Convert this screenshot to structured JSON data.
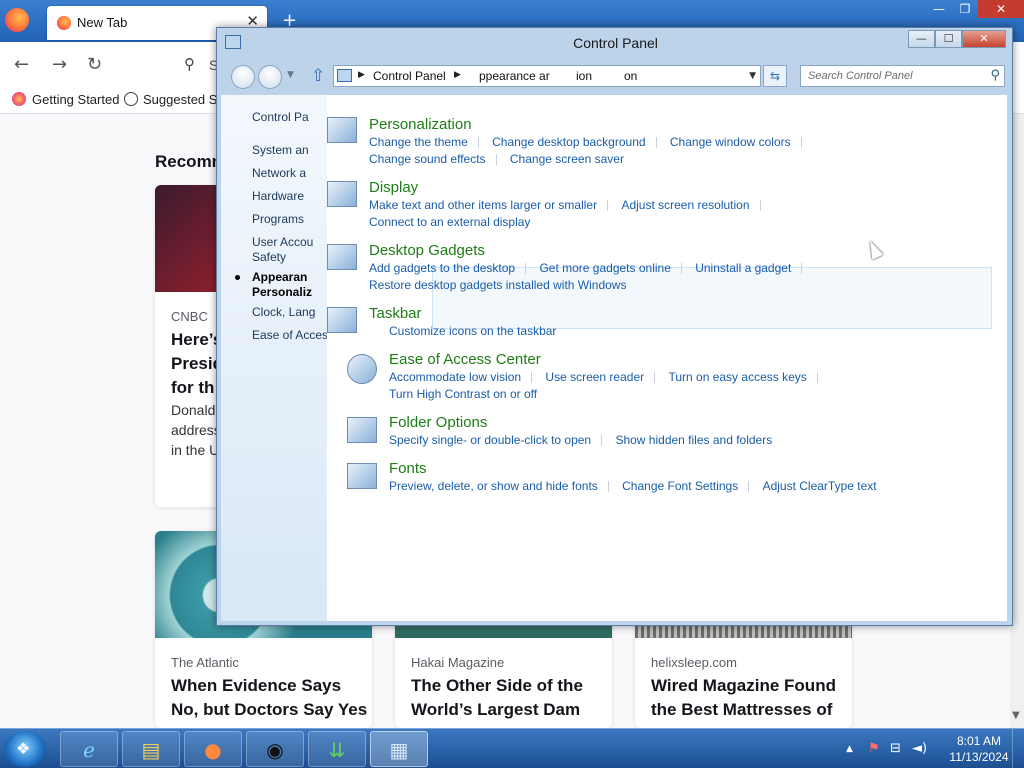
{
  "firefox": {
    "tab_label": "New Tab",
    "url_placeholder": "S",
    "bookmarks": [
      "Getting Started",
      "Suggested Sites"
    ],
    "recommended_heading": "Recomm",
    "cards": [
      {
        "source": "CNBC",
        "headline": [
          "Here’s",
          "Presid",
          "for th"
        ],
        "desc": [
          "Donald",
          "address",
          "in the U"
        ]
      },
      {
        "source": "The Atlantic",
        "headline": [
          "When Evidence Says",
          "No, but Doctors Say Yes"
        ]
      },
      {
        "source": "Hakai Magazine",
        "headline": [
          "The Other Side of the",
          "World’s Largest Dam"
        ]
      },
      {
        "source": "helixsleep.com",
        "headline": [
          "Wired Magazine Found",
          "the Best Mattresses of"
        ]
      }
    ]
  },
  "control_panel": {
    "title": "Control Panel",
    "address": {
      "root": "Control Panel",
      "segment1": "ppearance ar",
      "segment2": "ion",
      "segment3": "on"
    },
    "search_placeholder": "Search Control Panel",
    "nav": [
      {
        "label": "Control Pa"
      },
      {
        "label": "System an"
      },
      {
        "label": "Network a"
      },
      {
        "label": "Hardware"
      },
      {
        "label": "Programs"
      },
      {
        "label": "User Accou"
      },
      {
        "label": "Safety"
      },
      {
        "label": "Appearan"
      },
      {
        "label": "Personaliz"
      },
      {
        "label": "Clock, Lang"
      },
      {
        "label": "Ease of Access"
      }
    ],
    "categories": {
      "personalization": {
        "title": "Personalization",
        "links": [
          "Change the theme",
          "Change desktop background",
          "Change window colors",
          "Change sound effects",
          "Change screen saver"
        ]
      },
      "display": {
        "title": "Display",
        "links": [
          "Make text and other items larger or smaller",
          "Adjust screen resolution",
          "Connect to an external display"
        ]
      },
      "gadgets": {
        "title": "Desktop Gadgets",
        "links": [
          "Add gadgets to the desktop",
          "Get more gadgets online",
          "Uninstall a gadget",
          "Restore desktop gadgets installed with Windows"
        ]
      },
      "taskbar": {
        "title": "Taskbar",
        "links": [
          "Customize icons on the taskbar"
        ]
      },
      "ease": {
        "title": "Ease of Access Center",
        "links": [
          "Accommodate low vision",
          "Use screen reader",
          "Turn on easy access keys",
          "Turn High Contrast on or off"
        ]
      },
      "folder": {
        "title": "Folder Options",
        "links": [
          "Specify single- or double-click to open",
          "Show hidden files and folders"
        ]
      },
      "fonts": {
        "title": "Fonts",
        "links": [
          "Preview, delete, or show and hide fonts",
          "Change Font Settings",
          "Adjust ClearType text"
        ]
      }
    }
  },
  "taskbar": {
    "time": "8:01 AM",
    "date": "11/13/2024",
    "icons": [
      "start-orb",
      "internet-explorer",
      "file-explorer",
      "firefox",
      "obs",
      "download-manager",
      "control-panel"
    ]
  }
}
